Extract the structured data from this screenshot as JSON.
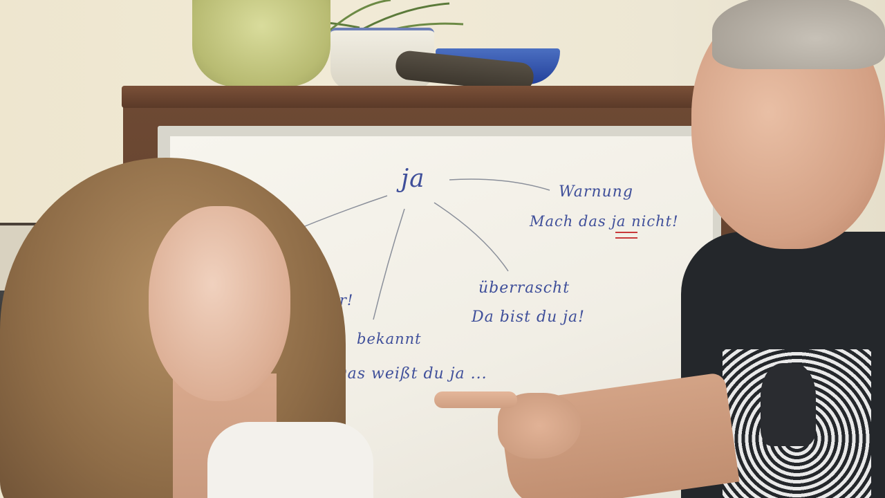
{
  "whiteboard": {
    "center_word": "ja",
    "branch_right_top": "Warnung",
    "example_right_top": "Mach das ja nicht!",
    "branch_left": "ja super!",
    "branch_right_mid": "überrascht",
    "example_right_mid": "Da bist du ja!",
    "branch_bottom": "bekannt",
    "example_bottom": "Das weißt du ja ...",
    "ink_color": "#3f4f9a",
    "underline_color": "#c8393a"
  }
}
